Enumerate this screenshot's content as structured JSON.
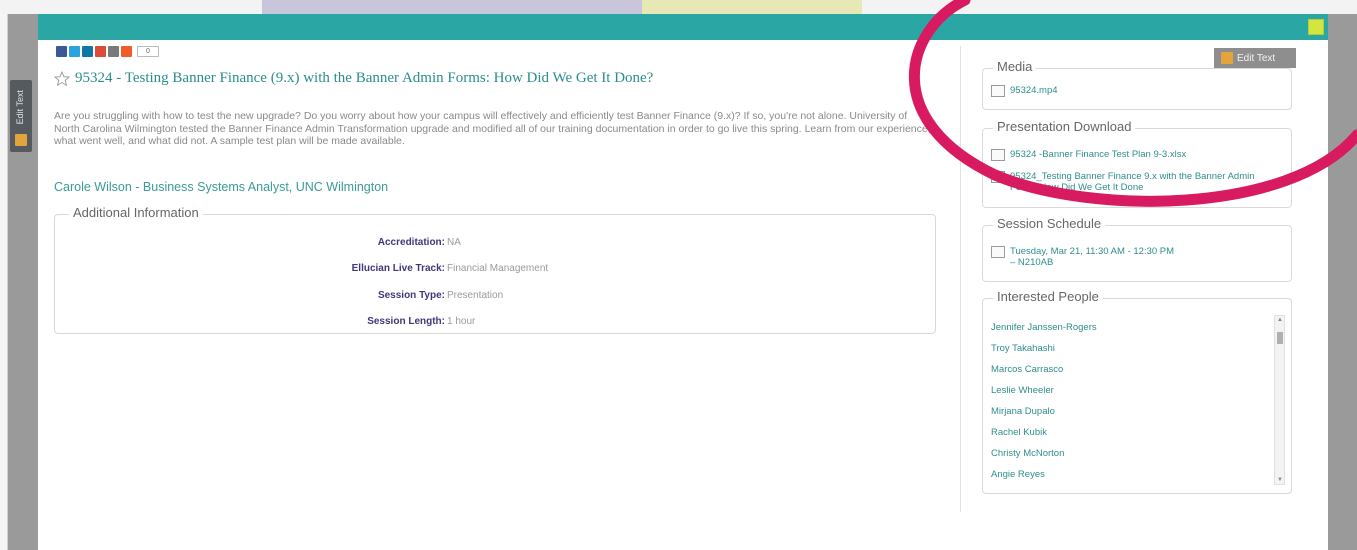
{
  "side_tab": {
    "label": "Edit Text"
  },
  "edit_text_button": {
    "label": "Edit Text"
  },
  "share_bar": {
    "icons": [
      "facebook-icon",
      "twitter-icon",
      "linkedin-icon",
      "googleplus-icon",
      "email-icon",
      "addthis-icon"
    ],
    "colors": [
      "#3b5998",
      "#2aa3e0",
      "#0e76a8",
      "#dd4b39",
      "#7a7a7a",
      "#f25c2a"
    ],
    "count": "0"
  },
  "session": {
    "title": "95324 - Testing Banner Finance (9.x) with the Banner Admin Forms: How Did We Get It Done?",
    "description": "Are you struggling with how to test the new upgrade? Do you worry about how your campus will effectively and efficiently test Banner Finance (9.x)? If so, you're not alone. University of North Carolina Wilmington tested the Banner Finance Admin Transformation upgrade and modified all of our training documentation in order to go live this spring. Learn from our experience, what went well, and what did not. A sample test plan will be made available.",
    "speaker": "Carole Wilson - Business Systems Analyst, UNC Wilmington"
  },
  "additional_info": {
    "title": "Additional Information",
    "rows": [
      {
        "key": "Accreditation:",
        "value": "NA"
      },
      {
        "key": "Ellucian Live Track:",
        "value": "Financial Management"
      },
      {
        "key": "Session Type:",
        "value": "Presentation"
      },
      {
        "key": "Session Length:",
        "value": "1 hour"
      }
    ]
  },
  "media": {
    "title": "Media",
    "items": [
      {
        "label": "95324.mp4"
      }
    ]
  },
  "presentation_download": {
    "title": "Presentation Download",
    "items": [
      {
        "label": "95324 -Banner Finance Test Plan 9-3.xlsx"
      },
      {
        "label": "95324_Testing Banner Finance 9.x with the Banner Admin Forms How Did We Get It Done"
      }
    ]
  },
  "session_schedule": {
    "title": "Session Schedule",
    "items": [
      {
        "label": "Tuesday, Mar 21, 11:30 AM - 12:30 PM",
        "room": "– N210AB"
      }
    ]
  },
  "interested_people": {
    "title": "Interested People",
    "people": [
      "Jennifer Janssen-Rogers",
      "Troy Takahashi",
      "Marcos Carrasco",
      "Leslie Wheeler",
      "Mirjana Dupalo",
      "Rachel Kubik",
      "Christy McNorton",
      "Angie Reyes"
    ]
  },
  "colors": {
    "header": "#2aa7a4",
    "link": "#2f8e8c",
    "annotation": "#d81b60",
    "close": "#d3e63d"
  }
}
